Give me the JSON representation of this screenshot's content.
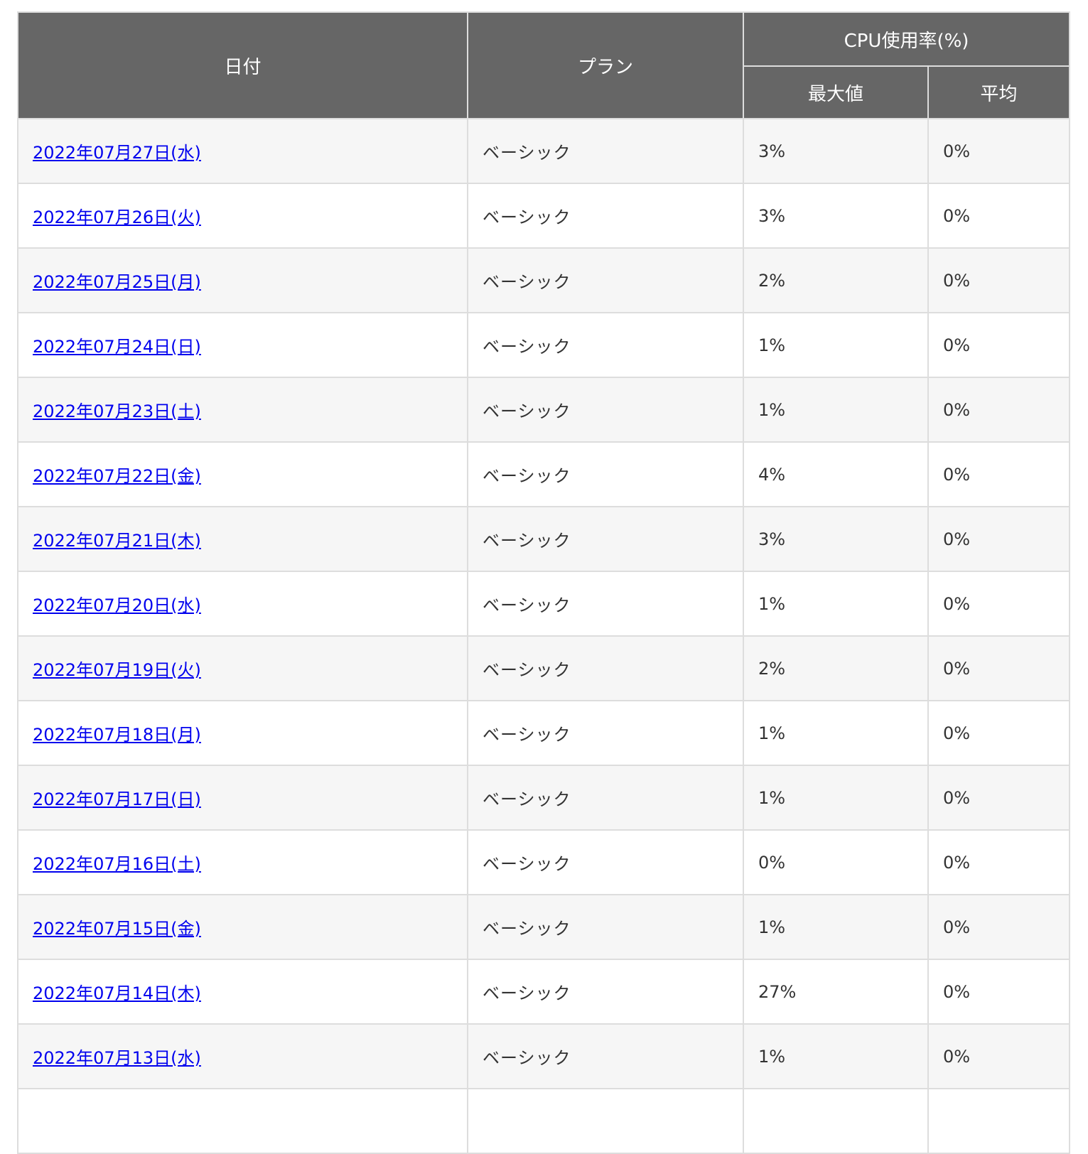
{
  "table": {
    "headers": {
      "date": "日付",
      "plan": "プラン",
      "cpu_group": "CPU使用率(%)",
      "max": "最大値",
      "avg": "平均"
    },
    "rows": [
      {
        "date": "2022年07月27日(水)",
        "plan": "ベーシック",
        "max": "3%",
        "avg": "0%"
      },
      {
        "date": "2022年07月26日(火)",
        "plan": "ベーシック",
        "max": "3%",
        "avg": "0%"
      },
      {
        "date": "2022年07月25日(月)",
        "plan": "ベーシック",
        "max": "2%",
        "avg": "0%"
      },
      {
        "date": "2022年07月24日(日)",
        "plan": "ベーシック",
        "max": "1%",
        "avg": "0%"
      },
      {
        "date": "2022年07月23日(土)",
        "plan": "ベーシック",
        "max": "1%",
        "avg": "0%"
      },
      {
        "date": "2022年07月22日(金)",
        "plan": "ベーシック",
        "max": "4%",
        "avg": "0%"
      },
      {
        "date": "2022年07月21日(木)",
        "plan": "ベーシック",
        "max": "3%",
        "avg": "0%"
      },
      {
        "date": "2022年07月20日(水)",
        "plan": "ベーシック",
        "max": "1%",
        "avg": "0%"
      },
      {
        "date": "2022年07月19日(火)",
        "plan": "ベーシック",
        "max": "2%",
        "avg": "0%"
      },
      {
        "date": "2022年07月18日(月)",
        "plan": "ベーシック",
        "max": "1%",
        "avg": "0%"
      },
      {
        "date": "2022年07月17日(日)",
        "plan": "ベーシック",
        "max": "1%",
        "avg": "0%"
      },
      {
        "date": "2022年07月16日(土)",
        "plan": "ベーシック",
        "max": "0%",
        "avg": "0%"
      },
      {
        "date": "2022年07月15日(金)",
        "plan": "ベーシック",
        "max": "1%",
        "avg": "0%"
      },
      {
        "date": "2022年07月14日(木)",
        "plan": "ベーシック",
        "max": "27%",
        "avg": "0%"
      },
      {
        "date": "2022年07月13日(水)",
        "plan": "ベーシック",
        "max": "1%",
        "avg": "0%"
      },
      {
        "date": "",
        "plan": "",
        "max": "",
        "avg": ""
      }
    ]
  },
  "colors": {
    "header_bg": "#666666",
    "header_text": "#ffffff",
    "row_alt_bg": "#f6f6f6",
    "border": "#dddddd",
    "link": "#0000ee"
  }
}
